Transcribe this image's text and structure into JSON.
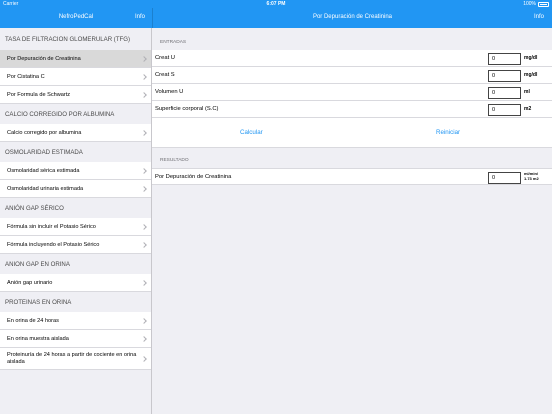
{
  "status": {
    "carrier": "Carrier",
    "time": "6:07 PM",
    "battery": "100%"
  },
  "master_nav": {
    "title": "NefroPedCal",
    "info": "Info"
  },
  "detail_nav": {
    "title": "Por Depuración de Creatinina",
    "info": "Info"
  },
  "sections": [
    {
      "header": "TASA DE FILTRACION GLOMERULAR (TFG)",
      "items": [
        "Por Depuración de Creatinina",
        "Por Cistatina C",
        "Por Formula de Schwartz"
      ]
    },
    {
      "header": "CALCIO CORREGIDO POR ALBUMINA",
      "items": [
        "Calcio corregido por albumina"
      ]
    },
    {
      "header": "OSMOLARIDAD ESTIMADA",
      "items": [
        "Osmolaridad sérica estimada",
        "Osmolaridad urinaria estimada"
      ]
    },
    {
      "header": "ANIÓN GAP SÉRICO",
      "items": [
        "Fórmula sin incluir el Potasio Sérico",
        "Fórmula incluyendo el Potasio Sérico"
      ]
    },
    {
      "header": "ANION GAP EN ORINA",
      "items": [
        "Anión gap urinario"
      ]
    },
    {
      "header": "PROTEINAS EN ORINA",
      "items": [
        "En orina de 24 horas",
        "En orina muestra aislada",
        "Proteinuría de 24 horas a partir de cociente en orina aislada"
      ]
    }
  ],
  "detail": {
    "entradas_label": "ENTRADAS",
    "fields": [
      {
        "label": "Creat U",
        "value": "0",
        "unit": "mg/dl"
      },
      {
        "label": "Creat S",
        "value": "0",
        "unit": "mg/dl"
      },
      {
        "label": "Volumen U",
        "value": "0",
        "unit": "ml"
      },
      {
        "label": "Superficie corporal (S.C)",
        "value": "0",
        "unit": "m2"
      }
    ],
    "calc_label": "Calcular",
    "reset_label": "Reiniciar",
    "resultado_label": "RESULTADO",
    "result": {
      "label": "Por Depuración de Creatinina",
      "value": "0",
      "unit_line1": "ml/min/",
      "unit_line2": "1.73 m2"
    }
  }
}
